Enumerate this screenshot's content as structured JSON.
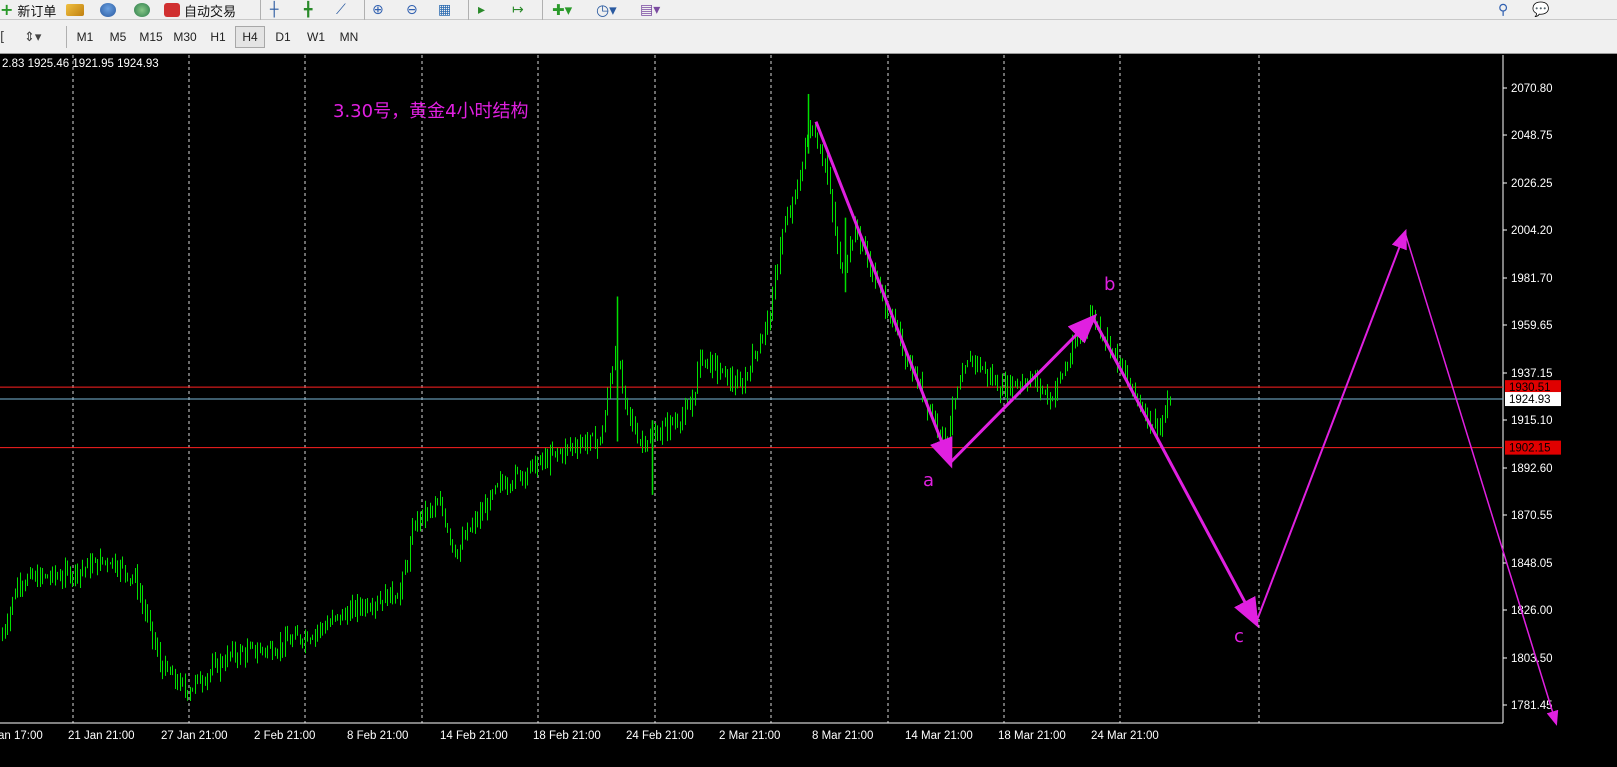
{
  "toolbar": {
    "new_order_label": "新订单",
    "auto_trading_label": "自动交易"
  },
  "timeframes": [
    {
      "label": "M1",
      "active": false
    },
    {
      "label": "M5",
      "active": false
    },
    {
      "label": "M15",
      "active": false
    },
    {
      "label": "M30",
      "active": false
    },
    {
      "label": "H1",
      "active": false
    },
    {
      "label": "H4",
      "active": true
    },
    {
      "label": "D1",
      "active": false
    },
    {
      "label": "W1",
      "active": false
    },
    {
      "label": "MN",
      "active": false
    }
  ],
  "chart": {
    "ohlc_text": "2.83 1925.46 1921.95 1924.93",
    "annotation_title": "3.30号，黄金4小时结构",
    "wave_labels": {
      "a": "a",
      "b": "b",
      "c": "c"
    },
    "price_levels": [
      "2070.80",
      "2048.75",
      "2026.25",
      "2004.20",
      "1981.70",
      "1959.65",
      "1937.15",
      "1915.10",
      "1892.60",
      "1870.55",
      "1848.05",
      "1826.00",
      "1803.50",
      "1781.45"
    ],
    "price_tag_upper": "1930.51",
    "price_tag_current": "1924.93",
    "price_tag_lower": "1902.15",
    "time_labels": [
      "an 17:00",
      "21 Jan 21:00",
      "27 Jan 21:00",
      "2 Feb 21:00",
      "8 Feb 21:00",
      "14 Feb 21:00",
      "18 Feb 21:00",
      "24 Feb 21:00",
      "2 Mar 21:00",
      "8 Mar 21:00",
      "14 Mar 21:00",
      "18 Mar 21:00",
      "24 Mar 21:00"
    ],
    "colors": {
      "background": "#000000",
      "candles": "#00e000",
      "grid": "#ffffff",
      "hline_red": "#ff2020",
      "hline_current": "#7ab8d8",
      "annotation": "#e020e0",
      "axis_text": "#ffffff",
      "tag_red_bg": "#e00000"
    }
  }
}
